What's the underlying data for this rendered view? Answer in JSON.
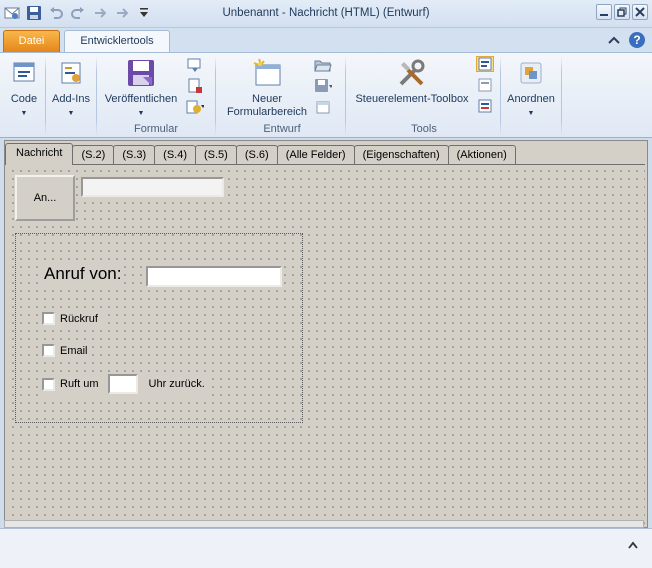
{
  "window": {
    "title": "Unbenannt  -  Nachricht (HTML)  (Entwurf)",
    "controls": [
      "minimize-icon",
      "restore-icon",
      "close-icon"
    ]
  },
  "qat": {
    "icons": [
      "app-icon",
      "save-icon",
      "undo-icon",
      "redo-icon",
      "up-arrow-icon",
      "down-arrow-icon",
      "customize-icon"
    ]
  },
  "tabs": {
    "file": "Datei",
    "developer": "Entwicklertools"
  },
  "ribbon": {
    "code": "Code",
    "addins": "Add-Ins",
    "publish": "Veröffentlichen",
    "group_formular": "Formular",
    "new_region_line1": "Neuer",
    "new_region_line2": "Formularbereich",
    "group_entwurf": "Entwurf",
    "toolbox": "Steuerelement-Toolbox",
    "group_tools": "Tools",
    "arrange": "Anordnen"
  },
  "form_tabs": [
    "Nachricht",
    "(S.2)",
    "(S.3)",
    "(S.4)",
    "(S.5)",
    "(S.6)",
    "(Alle Felder)",
    "(Eigenschaften)",
    "(Aktionen)"
  ],
  "form": {
    "to_button": "An...",
    "call_from_label": "Anruf von:",
    "callback": "Rückruf",
    "email": "Email",
    "calls_at": "Ruft um",
    "time_suffix": "Uhr zurück."
  }
}
